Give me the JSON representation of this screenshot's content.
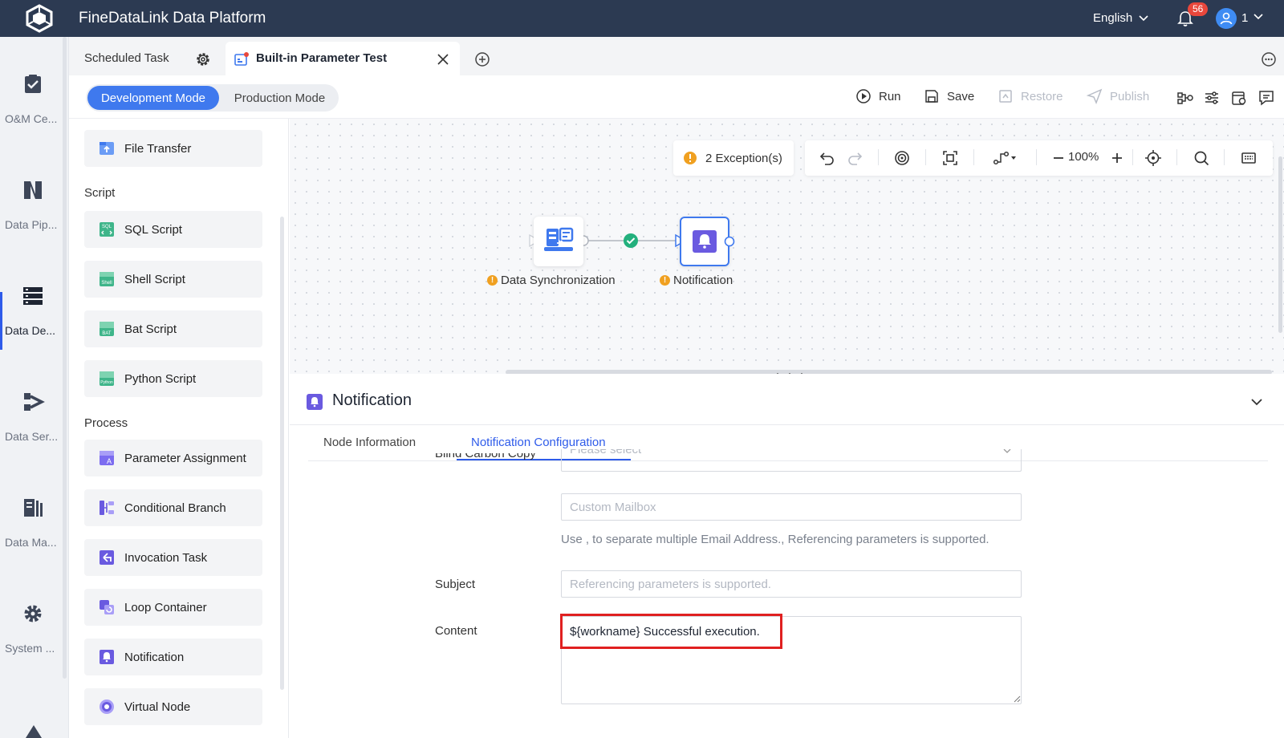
{
  "app": {
    "title": "FineDataLink Data Platform",
    "language": "English",
    "notification_count": "56",
    "user": "1"
  },
  "nav": {
    "items": [
      {
        "label": "O&M Ce...",
        "icon": "checklist-icon"
      },
      {
        "label": "Data Pip...",
        "icon": "pipeline-icon"
      },
      {
        "label": "Data De...",
        "icon": "data-dev-icon",
        "active": true
      },
      {
        "label": "Data Ser...",
        "icon": "data-service-icon"
      },
      {
        "label": "Data Ma...",
        "icon": "data-manage-icon"
      },
      {
        "label": "System ...",
        "icon": "gear-icon"
      }
    ]
  },
  "tabs": {
    "scheduled": "Scheduled Task",
    "active": "Built-in Parameter Test"
  },
  "mode": {
    "dev": "Development Mode",
    "prod": "Production Mode"
  },
  "toolbar": {
    "run": "Run",
    "save": "Save",
    "restore": "Restore",
    "publish": "Publish"
  },
  "palette": {
    "top_item": "File Transfer",
    "script_heading": "Script",
    "scripts": [
      "SQL Script",
      "Shell Script",
      "Bat Script",
      "Python Script"
    ],
    "process_heading": "Process",
    "process": [
      "Parameter Assignment",
      "Conditional Branch",
      "Invocation Task",
      "Loop Container",
      "Notification",
      "Virtual Node"
    ],
    "icon_tags": {
      "sql": "SQL",
      "shell": "Shell",
      "bat": "BAT",
      "python": "Python"
    }
  },
  "canvas": {
    "exceptions": "2 Exception(s)",
    "zoom": "100%",
    "nodes": [
      {
        "label": "Data Synchronization",
        "warning": "!"
      },
      {
        "label": "Notification",
        "warning": "!"
      }
    ]
  },
  "detail": {
    "title": "Notification",
    "tabs": {
      "node_info": "Node Information",
      "notify_cfg": "Notification Configuration"
    },
    "partial_label": "Blind Carbon Copy",
    "partial_placeholder": "Please select",
    "custom_mailbox_placeholder": "Custom Mailbox",
    "hint": "Use , to separate multiple Email Address.,  Referencing parameters is supported.",
    "subject_label": "Subject",
    "subject_placeholder": "Referencing parameters is supported.",
    "content_label": "Content",
    "content_value": "${workname} Successful execution."
  },
  "colors": {
    "accent": "#3f79ee",
    "topbar": "#2c3a52",
    "highlight": "#e02020",
    "warning": "#f0a020"
  }
}
